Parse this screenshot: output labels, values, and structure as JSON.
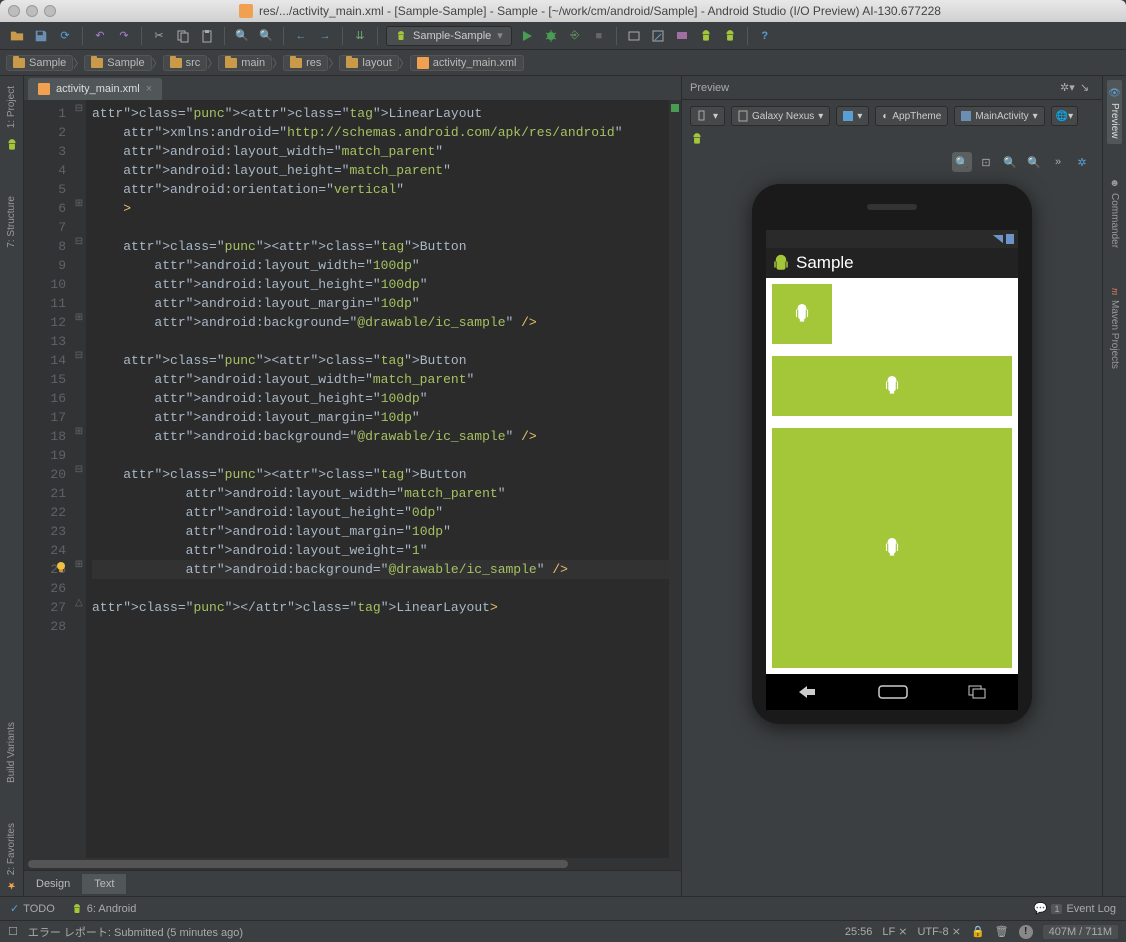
{
  "window_title": "res/.../activity_main.xml - [Sample-Sample] - Sample - [~/work/cm/android/Sample] - Android Studio (I/O Preview) AI-130.677228",
  "run_config": "Sample-Sample",
  "breadcrumbs": [
    "Sample",
    "Sample",
    "src",
    "main",
    "res",
    "layout",
    "activity_main.xml"
  ],
  "left_dock": {
    "project": "1: Project",
    "structure": "7: Structure",
    "build": "Build Variants",
    "favorites": "2: Favorites"
  },
  "right_dock": {
    "preview": "Preview",
    "commander": "Commander",
    "maven": "Maven Projects"
  },
  "editor_tab": "activity_main.xml",
  "line_count": 28,
  "code_lines": [
    "<LinearLayout",
    "    xmlns:android=\"http://schemas.android.com/apk/res/android\"",
    "    android:layout_width=\"match_parent\"",
    "    android:layout_height=\"match_parent\"",
    "    android:orientation=\"vertical\"",
    "    >",
    "",
    "    <Button",
    "        android:layout_width=\"100dp\"",
    "        android:layout_height=\"100dp\"",
    "        android:layout_margin=\"10dp\"",
    "        android:background=\"@drawable/ic_sample\" />",
    "",
    "    <Button",
    "        android:layout_width=\"match_parent\"",
    "        android:layout_height=\"100dp\"",
    "        android:layout_margin=\"10dp\"",
    "        android:background=\"@drawable/ic_sample\" />",
    "",
    "    <Button",
    "            android:layout_width=\"match_parent\"",
    "            android:layout_height=\"0dp\"",
    "            android:layout_margin=\"10dp\"",
    "            android:layout_weight=\"1\"",
    "            android:background=\"@drawable/ic_sample\" />",
    "",
    "</LinearLayout>",
    ""
  ],
  "editor_tabs": {
    "design": "Design",
    "text": "Text"
  },
  "preview": {
    "title": "Preview",
    "device": "Galaxy Nexus",
    "theme": "AppTheme",
    "activity": "MainActivity",
    "app_title": "Sample"
  },
  "bottom": {
    "todo": "TODO",
    "android": "6: Android",
    "event": "Event Log",
    "event_badge": "1"
  },
  "status": {
    "msg": "エラー レポート: Submitted (5 minutes ago)",
    "pos": "25:56",
    "sep": "LF",
    "enc": "UTF-8",
    "mem": "407M / 711M"
  }
}
